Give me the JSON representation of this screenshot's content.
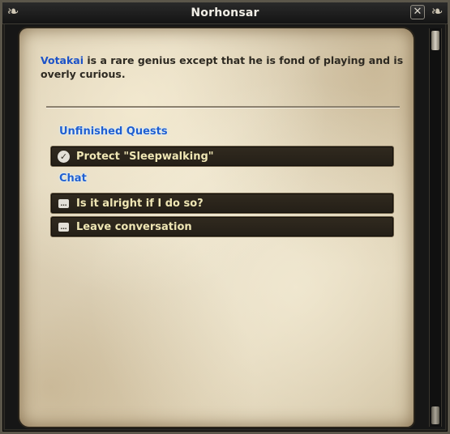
{
  "window": {
    "title": "Norhonsar",
    "close_glyph": "✕",
    "corner_glyph": "❧"
  },
  "dialog": {
    "npc_name": "Votakai",
    "text": " is a rare genius except that he is fond of playing and is overly curious."
  },
  "sections": {
    "quests_label": "Unfinished Quests",
    "chat_label": "Chat"
  },
  "quests": [
    {
      "label": "Protect \"Sleepwalking\"",
      "icon": "quest-check-icon"
    }
  ],
  "chat": [
    {
      "label": "Is it alright if I do so?",
      "icon": "speech-bubble-icon"
    },
    {
      "label": "Leave conversation",
      "icon": "speech-bubble-icon"
    }
  ],
  "colors": {
    "npc_name": "#1b52c8",
    "section_label": "#1f5fd0",
    "option_text": "#efe6b4",
    "parchment": "#e2d6bb"
  }
}
